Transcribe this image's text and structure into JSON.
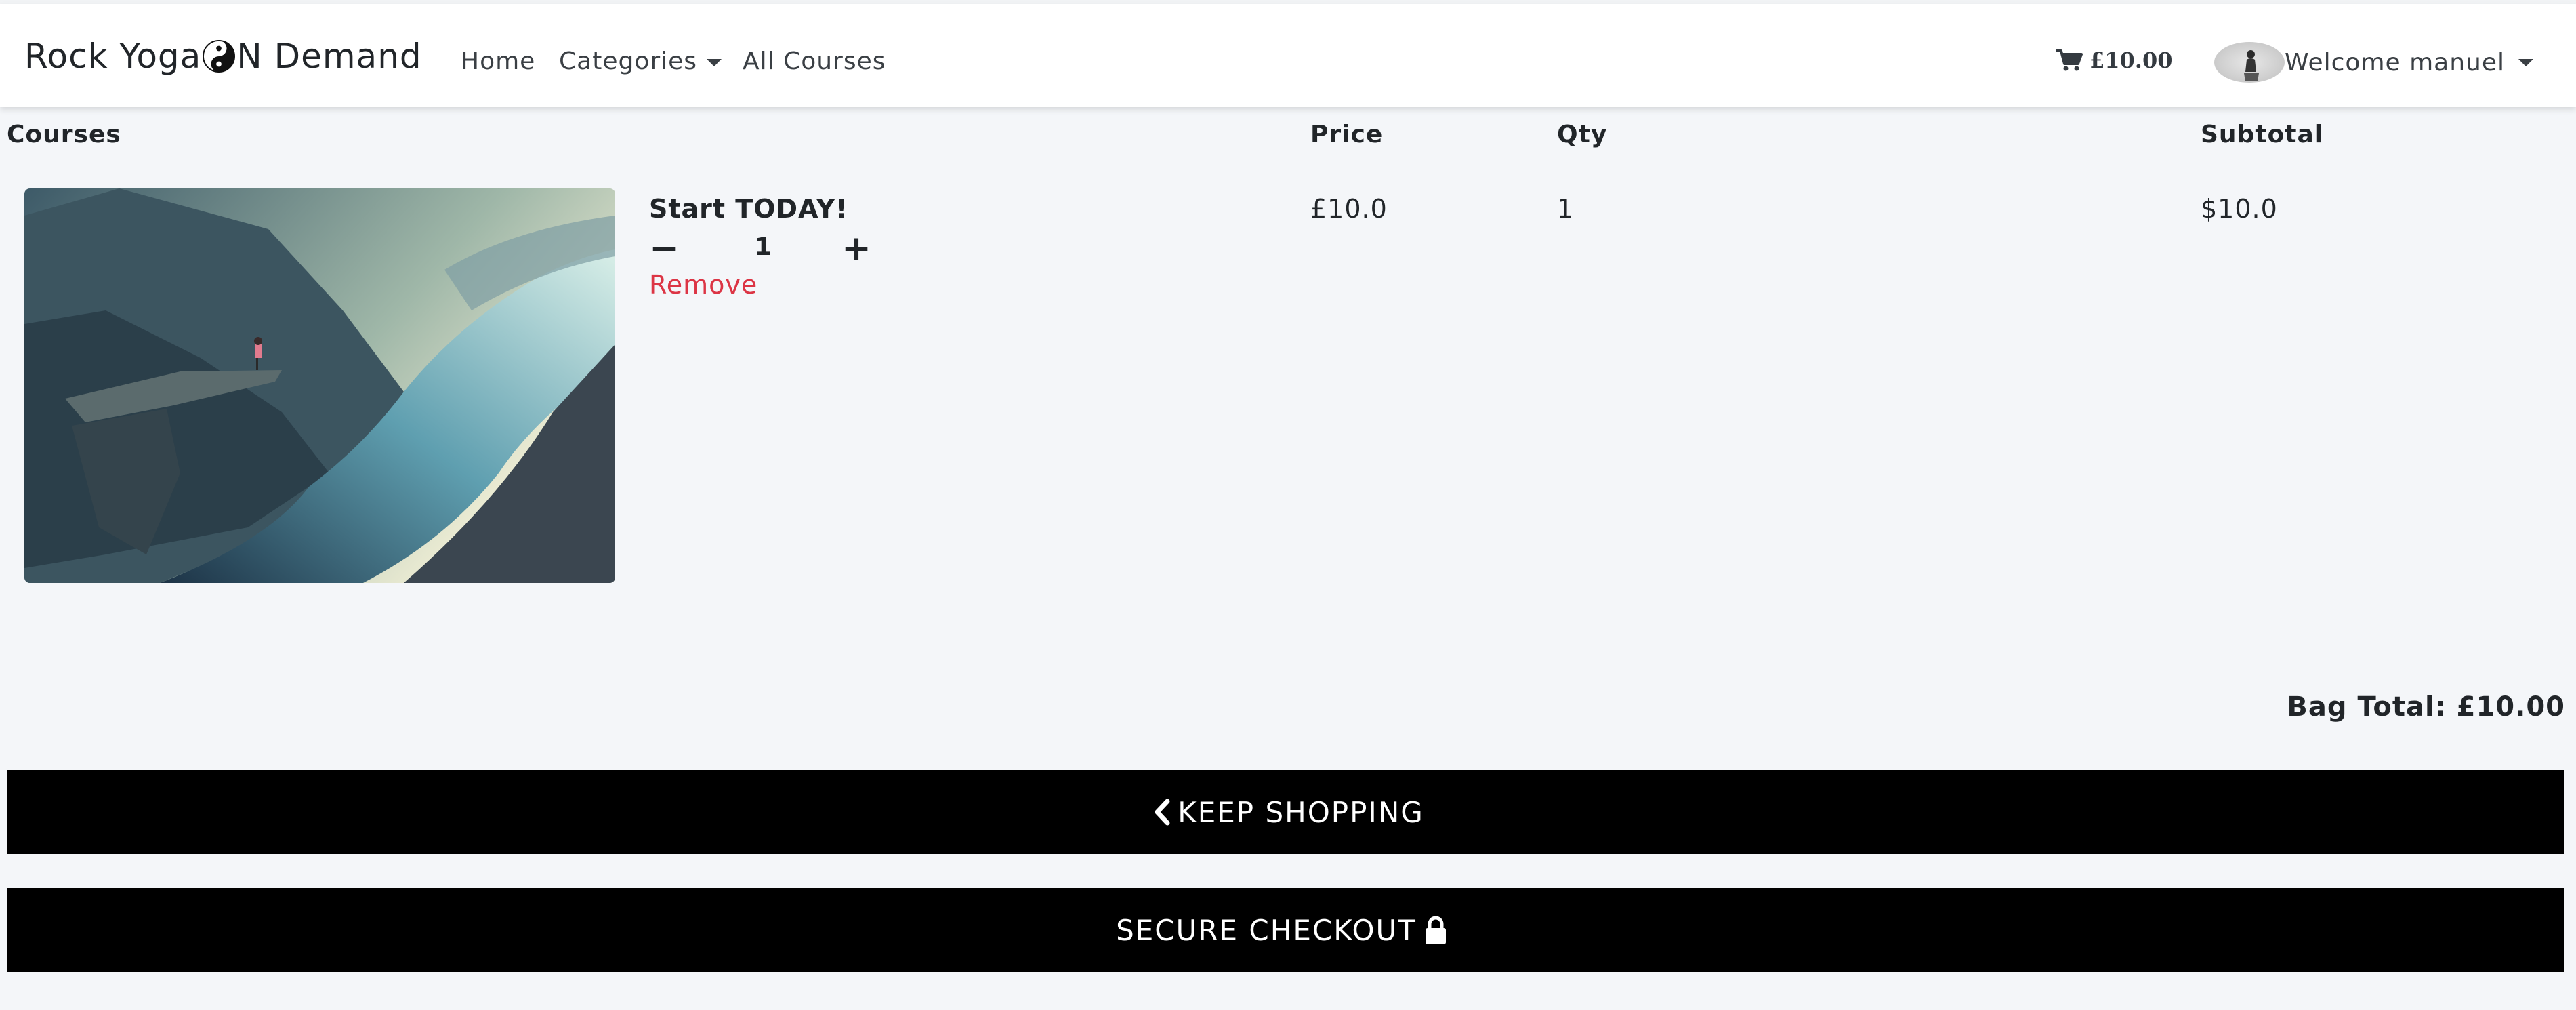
{
  "navbar": {
    "brand_before": "Rock Yoga ",
    "brand_after": "N Demand",
    "brand_icon": "yin-yang-icon",
    "links": {
      "home": "Home",
      "categories": "Categories",
      "all_courses": "All Courses"
    },
    "cart_total": "£10.00",
    "welcome": "Welcome manuel"
  },
  "table": {
    "headers": {
      "courses": "Courses",
      "price": "Price",
      "qty": "Qty",
      "subtotal": "Subtotal"
    },
    "rows": [
      {
        "title": "Start TODAY!",
        "quantity": "1",
        "remove_label": "Remove",
        "price": "£10.0",
        "qty": "1",
        "subtotal": "$10.0"
      }
    ]
  },
  "summary": {
    "bag_total": "Bag Total: £10.00"
  },
  "buttons": {
    "keep_shopping": "KEEP SHOPPING",
    "secure_checkout": "SECURE CHECKOUT"
  },
  "colors": {
    "page_bg": "#f4f6f9",
    "remove": "#dc3545",
    "button_bg": "#000000"
  }
}
